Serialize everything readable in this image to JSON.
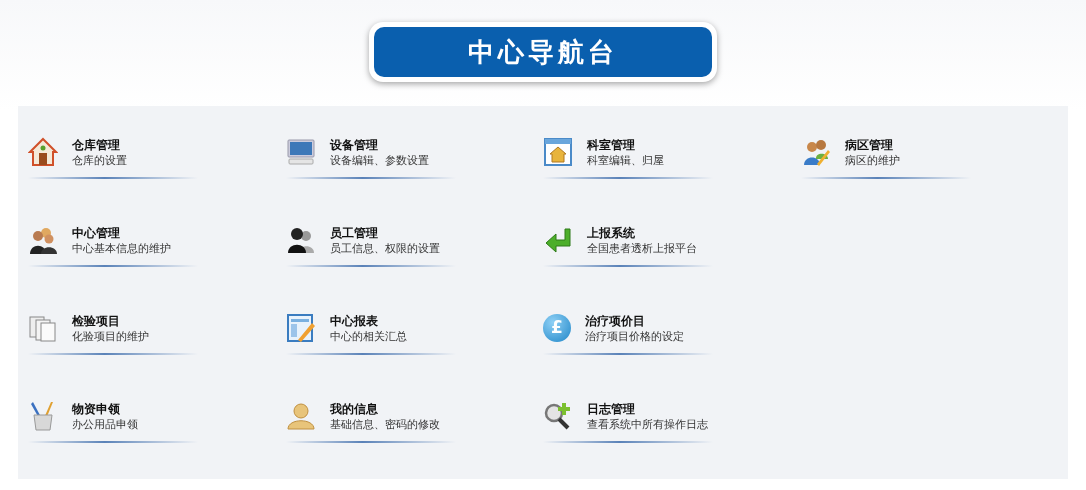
{
  "header": {
    "title": "中心导航台"
  },
  "rows": [
    {
      "items": [
        {
          "kind": "house",
          "title": "仓库管理",
          "subtitle": "仓库的设置"
        },
        {
          "kind": "monitor",
          "title": "设备管理",
          "subtitle": "设备编辑、参数设置"
        },
        {
          "kind": "window",
          "title": "科室管理",
          "subtitle": "科室编辑、归屋"
        },
        {
          "kind": "pair",
          "title": "病区管理",
          "subtitle": "病区的维护"
        }
      ]
    },
    {
      "items": [
        {
          "kind": "group",
          "title": "中心管理",
          "subtitle": "中心基本信息的维护"
        },
        {
          "kind": "users",
          "title": "员工管理",
          "subtitle": "员工信息、权限的设置"
        },
        {
          "kind": "arrow",
          "title": "上报系统",
          "subtitle": "全国患者透析上报平台"
        }
      ]
    },
    {
      "items": [
        {
          "kind": "pages",
          "title": "检验项目",
          "subtitle": "化验项目的维护"
        },
        {
          "kind": "report",
          "title": "中心报表",
          "subtitle": "中心的相关汇总"
        },
        {
          "kind": "coin",
          "glyph": "£",
          "title": "治疗项价目",
          "subtitle": "治疗项目价格的设定"
        }
      ]
    },
    {
      "items": [
        {
          "kind": "cup",
          "title": "物资申领",
          "subtitle": "办公用品申领"
        },
        {
          "kind": "person",
          "title": "我的信息",
          "subtitle": "基础信息、密码的修改"
        },
        {
          "kind": "magnifier",
          "title": "日志管理",
          "subtitle": "查看系统中所有操作日志"
        }
      ]
    }
  ]
}
